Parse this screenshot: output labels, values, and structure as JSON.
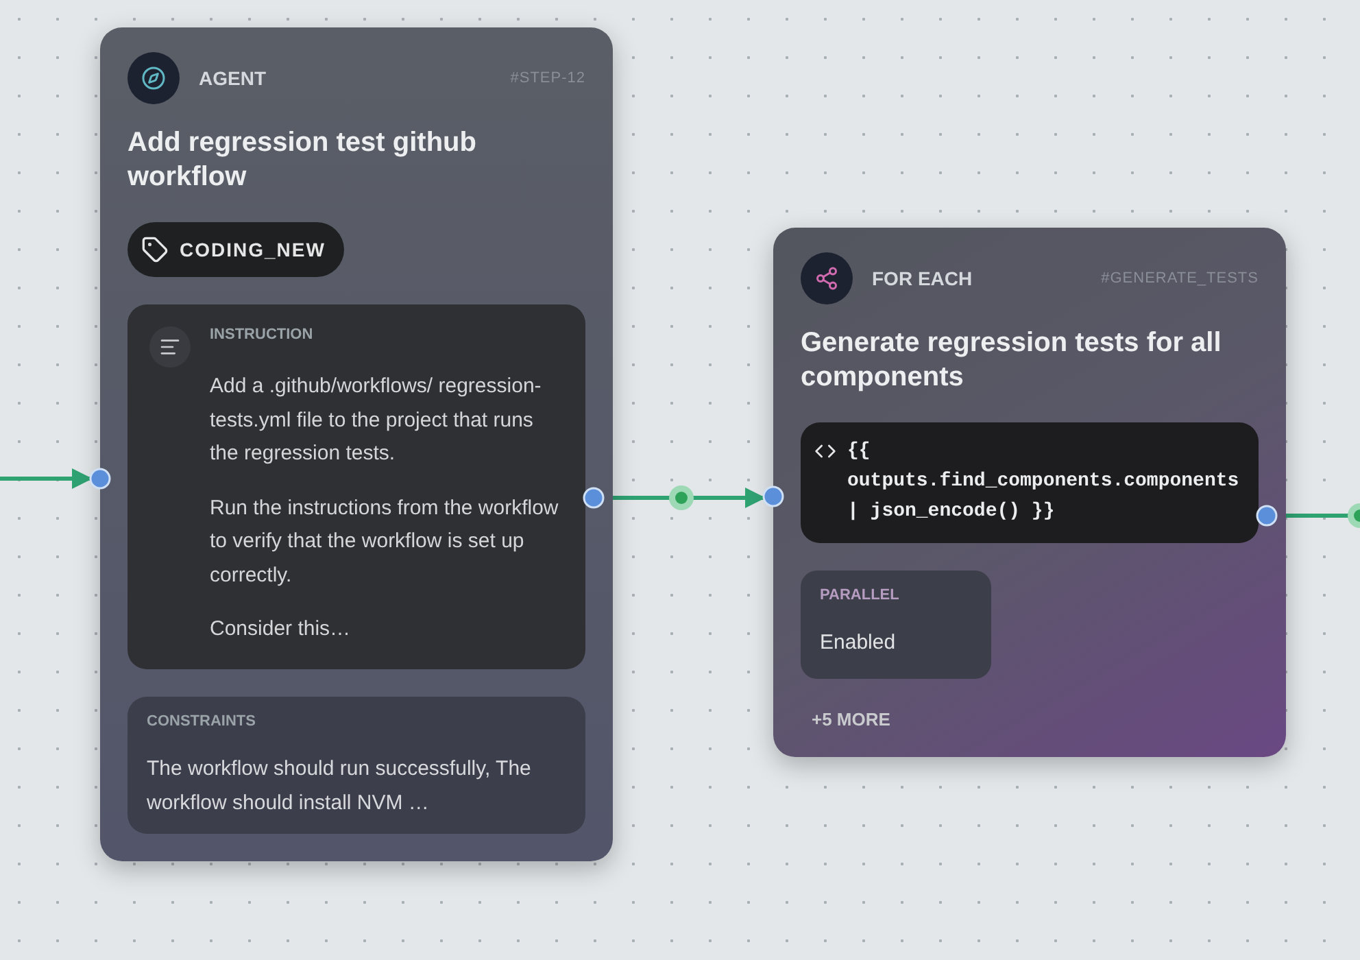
{
  "nodes": [
    {
      "kind": "agent",
      "type_label": "AGENT",
      "step_id": "#STEP-12",
      "title": "Add regression test github workflow",
      "tag": "CODING_NEW",
      "sections": [
        {
          "kind": "instruction",
          "label": "INSTRUCTION",
          "paragraphs": [
            "Add a .github/workflows/ regression-tests.yml file to the project that runs the regression tests.",
            "Run the instructions from the workflow to verify that the workflow is set up correctly.",
            "Consider this…"
          ]
        },
        {
          "kind": "constraints",
          "label": "CONSTRAINTS",
          "paragraphs": [
            "The workflow should run successfully, The workflow should install NVM …"
          ]
        }
      ]
    },
    {
      "kind": "for_each",
      "type_label": "FOR EACH",
      "step_id": "#GENERATE_TESTS",
      "title": "Generate regression tests for all components",
      "expression": "{{ outputs.find_components.components | json_encode() }}",
      "fields": [
        {
          "label": "PARALLEL",
          "value": "Enabled"
        }
      ],
      "more": "+5 MORE"
    }
  ]
}
